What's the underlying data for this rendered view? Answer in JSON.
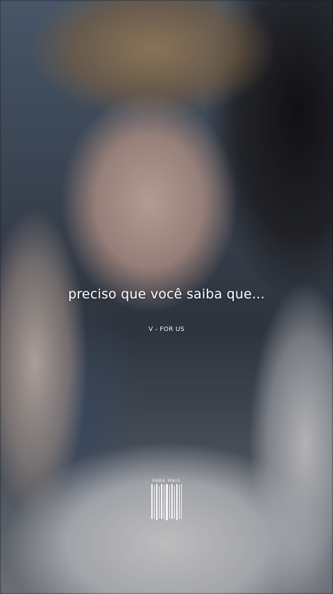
{
  "lyric": {
    "text": "preciso que você saiba que..."
  },
  "credit": {
    "text": "V - FOR US"
  },
  "watermark": {
    "text": "PARA MAIS"
  },
  "colors": {
    "text": "#ffffff"
  }
}
